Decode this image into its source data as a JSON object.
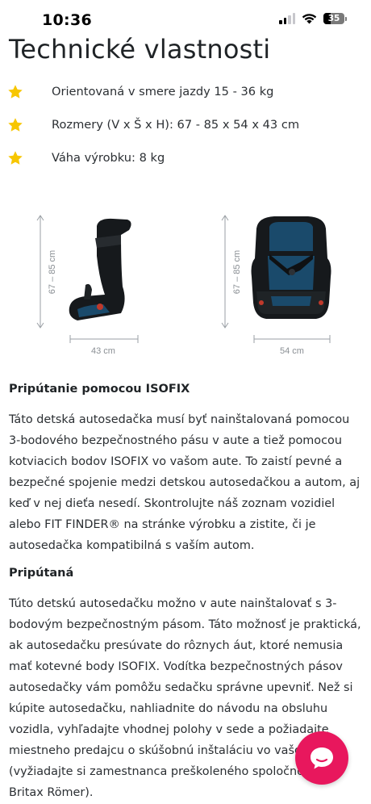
{
  "status_bar": {
    "time": "10:36",
    "battery_level": "35",
    "icons": [
      "cellular-signal-icon",
      "wifi-icon",
      "battery-icon"
    ]
  },
  "page": {
    "title": "Technické vlastnosti"
  },
  "specs": [
    {
      "icon": "star-icon",
      "text": "Orientovaná v smere jazdy 15 - 36 kg"
    },
    {
      "icon": "star-icon",
      "text": "Rozmery (V x Š x H): 67 - 85 x 54 x 43 cm"
    },
    {
      "icon": "star-icon",
      "text": "Váha výrobku: 8 kg"
    }
  ],
  "figures": {
    "side": {
      "height_label": "67 – 85 cm",
      "depth_label": "43 cm"
    },
    "front": {
      "height_label": "67 – 85 cm",
      "width_label": "54 cm"
    }
  },
  "sections": [
    {
      "heading": "Pripútanie pomocou ISOFIX",
      "body": "Táto detská autosedačka musí byť nainštalovaná pomocou 3-bodového bezpečnostného pásu v aute a tiež pomocou kotviacich bodov ISOFIX vo vašom aute. To zaistí pevné a bezpečné spojenie medzi detskou autosedačkou a autom, aj keď v nej dieťa nesedí. Skontrolujte náš zoznam vozidiel alebo FIT FINDER® na stránke výrobku a zistite, či je autosedačka kompatibilná s vaším autom."
    },
    {
      "heading": "Pripútaná",
      "body": "Túto detskú autosedačku možno v aute nainštalovať s 3-bodovým bezpečnostným pásom. Táto možnosť je praktická, ak autosedačku presúvate do rôznych áut, ktoré nemusia mať kotevné body ISOFIX. Vodítka bezpečnostných pásov autosedačky vám pomôžu sedačku správne upevniť. Než si kúpite autosedačku, nahliadnite do návodu na obsluhu vozidla, vyhľadajte vhodnej polohy v sede a požiadajte miestneho predajcu o skúšobnú inštaláciu vo vašom aute (vyžiadajte si zamestnanca preškoleného spoločnosťou Britax Römer)."
    }
  ],
  "chat": {
    "icon": "chat-bubble-icon"
  },
  "colors": {
    "accent_star": "#f7c600",
    "chat_button": "#e8175d",
    "seat_body": "#16191c",
    "seat_fabric": "#1a4a6b"
  }
}
